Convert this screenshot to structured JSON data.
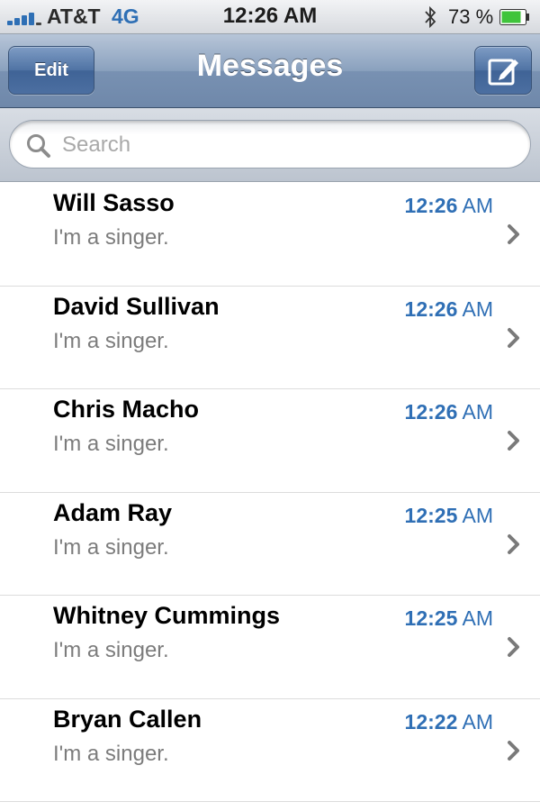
{
  "status_bar": {
    "carrier": "AT&T",
    "network": "4G",
    "time": "12:26 AM",
    "battery": "73 %",
    "icons": [
      "signal-icon",
      "bluetooth-icon",
      "battery-icon"
    ]
  },
  "nav": {
    "edit_label": "Edit",
    "title": "Messages",
    "compose_icon": "compose-icon"
  },
  "search": {
    "placeholder": "Search"
  },
  "messages": [
    {
      "name": "Will Sasso",
      "preview": "I'm a singer.",
      "time": "12:26",
      "ampm": "AM"
    },
    {
      "name": "David Sullivan",
      "preview": "I'm a singer.",
      "time": "12:26",
      "ampm": "AM"
    },
    {
      "name": "Chris Macho",
      "preview": "I'm a singer.",
      "time": "12:26",
      "ampm": "AM"
    },
    {
      "name": "Adam Ray",
      "preview": "I'm a singer.",
      "time": "12:25",
      "ampm": "AM"
    },
    {
      "name": "Whitney Cummings",
      "preview": "I'm a singer.",
      "time": "12:25",
      "ampm": "AM"
    },
    {
      "name": "Bryan Callen",
      "preview": "I'm a singer.",
      "time": "12:22",
      "ampm": "AM"
    }
  ],
  "colors": {
    "accent": "#2f6fb5",
    "nav_bar": "#7891b2",
    "battery_fill": "#3fc43b"
  }
}
